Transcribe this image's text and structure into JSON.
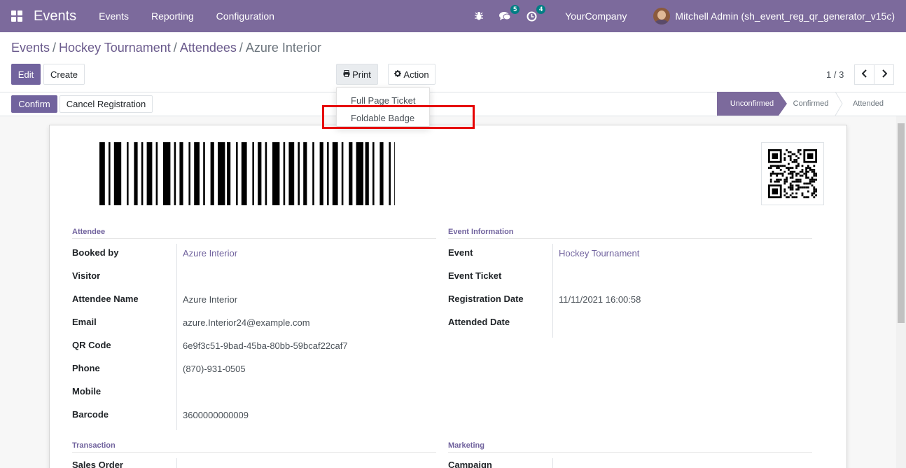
{
  "navbar": {
    "brand": "Events",
    "menu": [
      "Events",
      "Reporting",
      "Configuration"
    ],
    "messages_count": "5",
    "activities_count": "4",
    "company": "YourCompany",
    "user": "Mitchell Admin (sh_event_reg_qr_generator_v15c)",
    "colors": {
      "navbar_bg": "#7c6a9c",
      "badge_bg": "#017e84"
    }
  },
  "breadcrumb": {
    "items": [
      "Events",
      "Hockey Tournament",
      "Attendees"
    ],
    "current": "Azure Interior"
  },
  "toolbar": {
    "edit_label": "Edit",
    "create_label": "Create",
    "print_label": "Print",
    "action_label": "Action",
    "pager_value": "1 / 3"
  },
  "print_menu": {
    "items": [
      "Full Page Ticket",
      "Foldable Badge"
    ],
    "highlighted": "Foldable Badge"
  },
  "statusbar": {
    "confirm_label": "Confirm",
    "cancel_label": "Cancel Registration",
    "stages": [
      "Unconfirmed",
      "Confirmed",
      "Attended"
    ],
    "active_stage": "Unconfirmed"
  },
  "form": {
    "attendee": {
      "title": "Attendee",
      "fields": [
        {
          "label": "Booked by",
          "value": "Azure Interior"
        },
        {
          "label": "Visitor",
          "value": ""
        },
        {
          "label": "Attendee Name",
          "value": "Azure Interior"
        },
        {
          "label": "Email",
          "value": "azure.Interior24@example.com"
        },
        {
          "label": "QR Code",
          "value": "6e9f3c51-9bad-45ba-80bb-59bcaf22caf7"
        },
        {
          "label": "Phone",
          "value": "(870)-931-0505"
        },
        {
          "label": "Mobile",
          "value": ""
        },
        {
          "label": "Barcode",
          "value": "3600000000009"
        }
      ]
    },
    "event_info": {
      "title": "Event Information",
      "fields": [
        {
          "label": "Event",
          "value": "Hockey Tournament"
        },
        {
          "label": "Event Ticket",
          "value": ""
        },
        {
          "label": "Registration Date",
          "value": "11/11/2021 16:00:58"
        },
        {
          "label": "Attended Date",
          "value": ""
        }
      ]
    },
    "transaction": {
      "title": "Transaction",
      "fields": [
        {
          "label": "Sales Order",
          "value": ""
        }
      ]
    },
    "marketing": {
      "title": "Marketing",
      "fields": [
        {
          "label": "Campaign",
          "value": ""
        }
      ]
    }
  }
}
